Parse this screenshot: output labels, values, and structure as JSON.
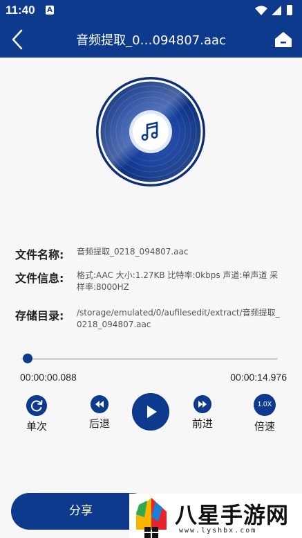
{
  "status_bar": {
    "time": "11:40",
    "notification_icon": "A",
    "icons": [
      "wifi-icon",
      "signal-icon",
      "battery-icon"
    ]
  },
  "header": {
    "title": "音频提取_0…094807.aac",
    "back_icon": "chevron-left-icon",
    "home_icon": "home-icon"
  },
  "disc": {
    "icon": "music-note-icon"
  },
  "file_info": {
    "name_label": "文件名称:",
    "name_value": "音频提取_0218_094807.aac",
    "info_label": "文件信息:",
    "info_value": "格式:AAC  大小:1.27KB  比特率:0kbps  声道:单声道  采样率:8000HZ",
    "dir_label": "存储目录:",
    "dir_value": "/storage/emulated/0/aufilesedit/extract/音频提取_0218_094807.aac"
  },
  "player": {
    "current_time": "00:00:00.088",
    "total_time": "00:00:14.976",
    "progress": 0.006,
    "controls": {
      "loop_label": "单次",
      "rewind_label": "后退",
      "forward_label": "前进",
      "speed_label": "倍速",
      "speed_value": "1.0X"
    }
  },
  "share": {
    "label": "分享"
  },
  "watermark": {
    "text": "八星手游网",
    "url": "www.lyshbx.com"
  },
  "colors": {
    "primary": "#0d3a8c",
    "background": "#f7f7f7"
  }
}
